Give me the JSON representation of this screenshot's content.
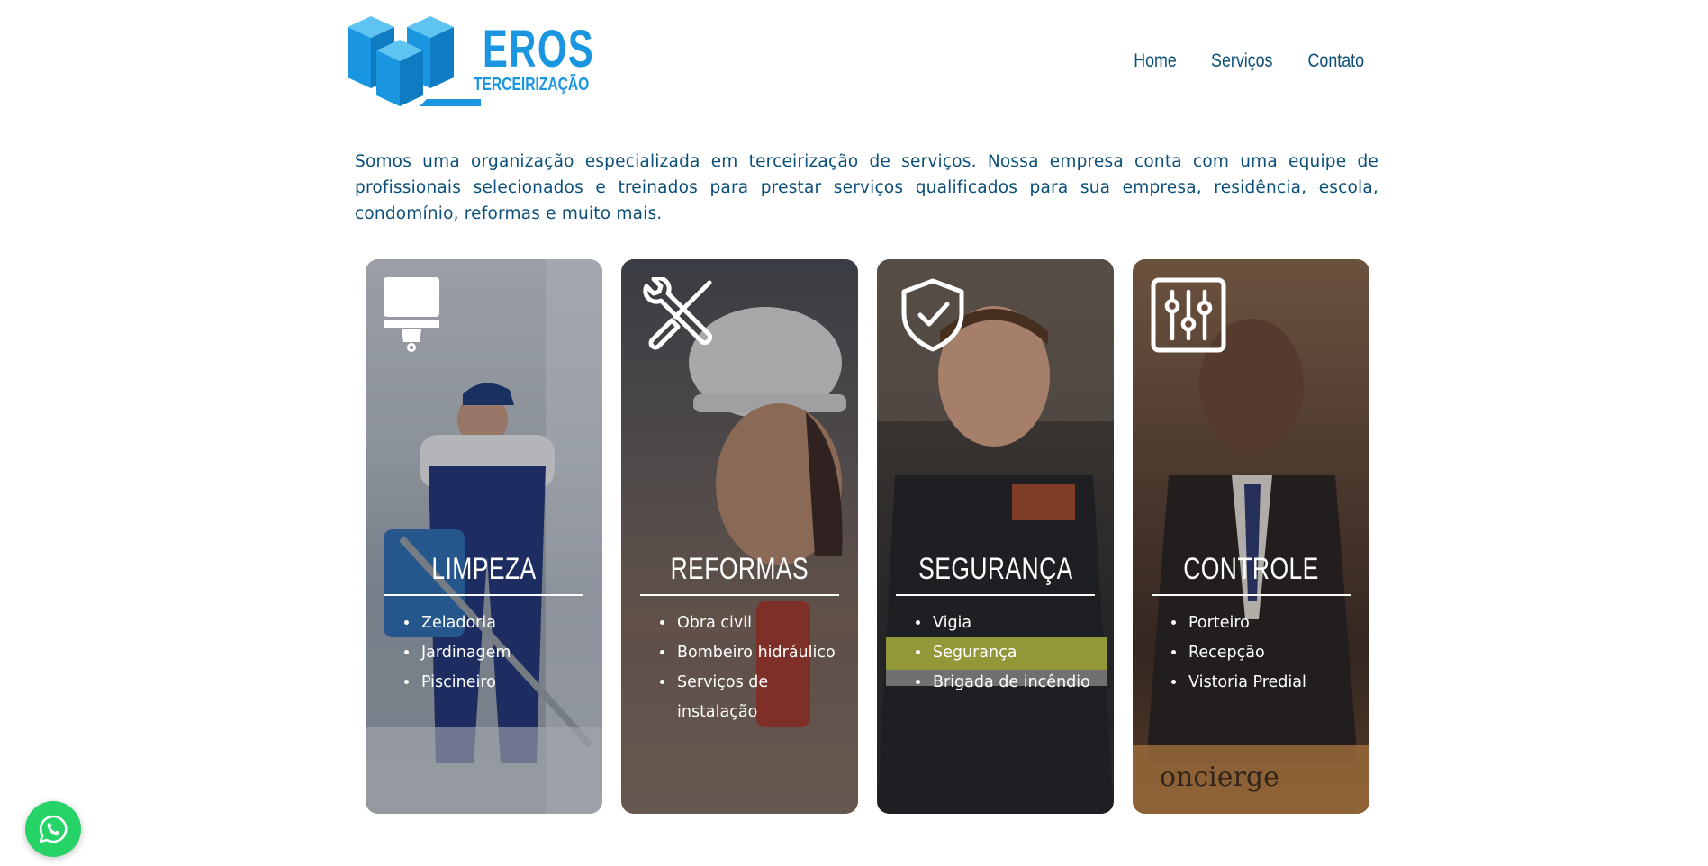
{
  "brand": {
    "name": "EROS",
    "subtitle": "TERCEIRIZAÇÃO",
    "primary_color": "#1a96e0",
    "text_color": "#0a4f7a"
  },
  "nav": {
    "items": [
      {
        "label": "Home"
      },
      {
        "label": "Serviços"
      },
      {
        "label": "Contato"
      }
    ]
  },
  "intro": {
    "text": "Somos uma organização especializada em terceirização de serviços. Nossa empresa conta com uma equipe de profissionais selecionados e treinados para prestar serviços qualificados para sua empresa, residência, escola, condomínio, reformas e muito mais."
  },
  "cards": [
    {
      "title": "LIMPEZA",
      "icon": "paint-scraper-icon",
      "items": [
        "Zeladoria",
        "Jardinagem",
        "Piscineiro"
      ]
    },
    {
      "title": "REFORMAS",
      "icon": "tools-icon",
      "items": [
        "Obra civil",
        "Bombeiro hidráulico",
        "Serviços de instalação"
      ]
    },
    {
      "title": "SEGURANÇA",
      "icon": "shield-check-icon",
      "items": [
        "Vigia",
        "Segurança",
        "Brigada de incêndio"
      ]
    },
    {
      "title": "CONTROLE",
      "icon": "sliders-icon",
      "items": [
        "Porteiro",
        "Recepção",
        "Vistoria Predial"
      ]
    }
  ],
  "whatsapp": {
    "icon": "whatsapp-icon",
    "color": "#25d366"
  }
}
